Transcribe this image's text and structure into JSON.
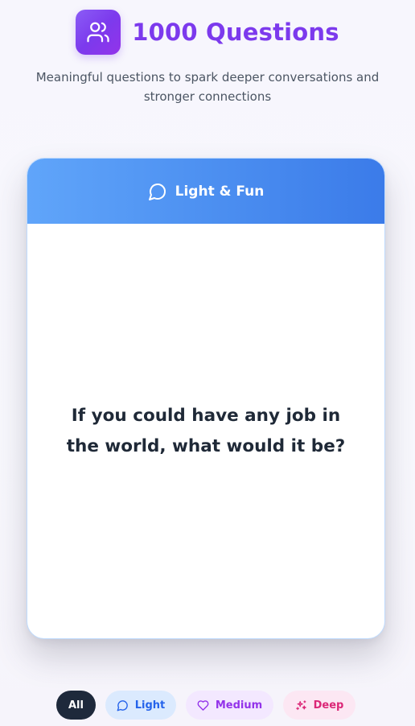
{
  "app": {
    "title": "1000 Questions",
    "subtitle": "Meaningful questions to spark deeper conversations and stronger connections",
    "logo_icon": "users-icon"
  },
  "card": {
    "category_label": "Light & Fun",
    "category_icon": "message-circle-icon",
    "question": "If you could have any job in the world, what would it be?"
  },
  "filters": [
    {
      "label": "All",
      "icon": null,
      "selected": true
    },
    {
      "label": "Light",
      "icon": "message-circle-icon",
      "selected": false
    },
    {
      "label": "Medium",
      "icon": "heart-icon",
      "selected": false
    },
    {
      "label": "Deep",
      "icon": "sparkles-icon",
      "selected": false
    }
  ],
  "colors": {
    "brand": "#7c3aed",
    "light": "#3b82f6",
    "medium": "#9333ea",
    "deep": "#db2777",
    "selected_pill": "#1e293b"
  }
}
